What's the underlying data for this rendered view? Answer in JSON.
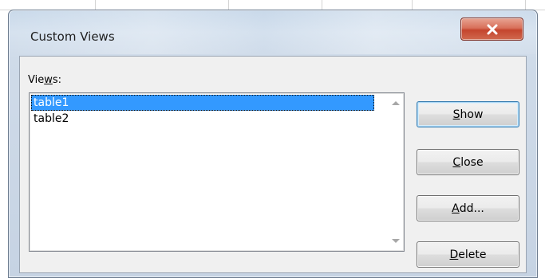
{
  "dialog": {
    "title": "Custom Views",
    "close_icon": "close-x-icon"
  },
  "views": {
    "label_prefix": "Vie",
    "label_accel": "w",
    "label_suffix": "s:",
    "items": [
      {
        "label": "table1",
        "selected": true
      },
      {
        "label": "table2",
        "selected": false
      }
    ]
  },
  "buttons": {
    "show": {
      "accel": "S",
      "rest": "how"
    },
    "close": {
      "accel": "C",
      "rest": "lose"
    },
    "add": {
      "accel": "A",
      "rest": "dd..."
    },
    "delete": {
      "accel": "D",
      "rest": "elete"
    }
  },
  "colors": {
    "selection": "#3399ff",
    "close_button": "#c4452d"
  }
}
